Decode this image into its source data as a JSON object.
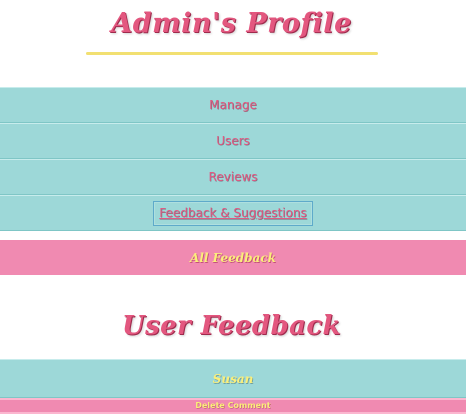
{
  "header": {
    "title": "Admin's Profile"
  },
  "nav": {
    "items": [
      {
        "label": "Manage"
      },
      {
        "label": "Users"
      },
      {
        "label": "Reviews"
      },
      {
        "label": "Feedback & Suggestions"
      }
    ]
  },
  "subnav": {
    "all_feedback_label": "All Feedback"
  },
  "section": {
    "title": "User Feedback"
  },
  "feedback": {
    "user_name": "Susan",
    "delete_label": "Delete Comment"
  },
  "colors": {
    "teal_bar": "#9dd8d8",
    "pink_bar": "#f08ab1",
    "pink_text": "#e3577f",
    "yellow_text": "#fbef7a",
    "rule_yellow": "#f2e071"
  }
}
